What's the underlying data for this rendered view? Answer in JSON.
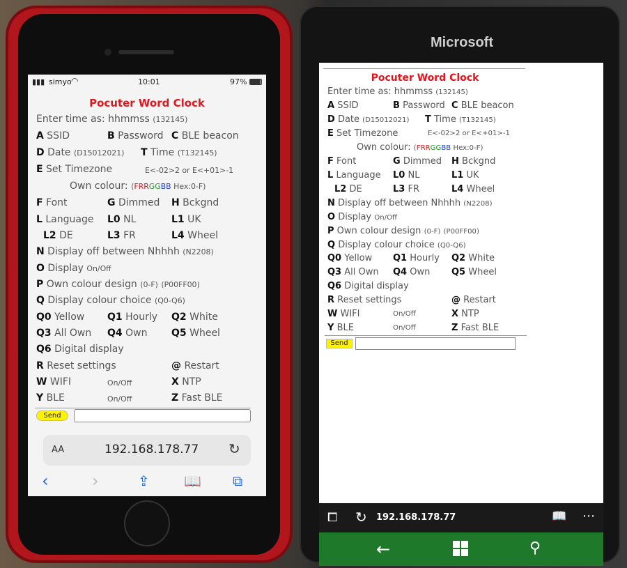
{
  "iphone": {
    "status": {
      "carrier": "simyo",
      "time": "10:01",
      "battery": "97%"
    },
    "title": "Pocuter Word Clock",
    "enter_time": "Enter time as: hhmmss",
    "enter_time_ex": "(132145)",
    "url": "192.168.178.77",
    "aa_label": "AA",
    "send_label": "Send"
  },
  "lumia": {
    "brand": "Microsoft",
    "title": "Pocuter Word Clock",
    "enter_time": "Enter time as: hhmmss",
    "enter_time_ex": "(132145)",
    "url": "192.168.178.77",
    "send_label": "Send"
  },
  "menu": {
    "a_key": "A",
    "a_label": "SSID",
    "b_key": "B",
    "b_label": "Password",
    "c_key": "C",
    "c_label": "BLE beacon",
    "d_key": "D",
    "d_label": "Date",
    "d_ex": "(D15012021)",
    "t_key": "T",
    "t_label": "Time",
    "t_ex": "(T132145)",
    "e_key": "E",
    "e_label": "Set Timezone",
    "e_ex": "E<-02>2 or E<+01>-1",
    "own_colour": "Own colour:",
    "own_ex_pre": "(",
    "own_rr": "RR",
    "own_gg": "GG",
    "own_bb": "BB",
    "own_ex_post": "Hex:0-F)",
    "own_f": "F",
    "f_key": "F",
    "f_label": "Font",
    "g_key": "G",
    "g_label": "Dimmed",
    "h_key": "H",
    "h_label": "Bckgnd",
    "l_key": "L",
    "l_label": "Language",
    "l0_key": "L0",
    "l0_label": "NL",
    "l1_key": "L1",
    "l1_label": "UK",
    "l2_key": "L2",
    "l2_label": "DE",
    "l3_key": "L3",
    "l3_label": "FR",
    "l4_key": "L4",
    "l4_label": "Wheel",
    "n_key": "N",
    "n_label": "Display off between Nhhhh",
    "n_ex": "(N2208)",
    "o_key": "O",
    "o_label": "Display",
    "o_ex": "On/Off",
    "p_key": "P",
    "p_label": "Own colour design",
    "p_ex1": "(0-F)",
    "p_ex2": "(P00FF00)",
    "q_key": "Q",
    "q_label": "Display colour choice",
    "q_ex": "(Q0-Q6)",
    "q0_key": "Q0",
    "q0_label": "Yellow",
    "q1_key": "Q1",
    "q1_label": "Hourly",
    "q2_key": "Q2",
    "q2_label": "White",
    "q3_key": "Q3",
    "q3_label": "All Own",
    "q4_key": "Q4",
    "q4_label": "Own",
    "q5_key": "Q5",
    "q5_label": "Wheel",
    "q6_key": "Q6",
    "q6_label": "Digital display",
    "r_key": "R",
    "r_label": "Reset settings",
    "at_key": "@",
    "at_label": "Restart",
    "w_key": "W",
    "w_label": "WIFI",
    "w_ex": "On/Off",
    "x_key": "X",
    "x_label": "NTP",
    "y_key": "Y",
    "y_label": "BLE",
    "y_ex": "On/Off",
    "z_key": "Z",
    "z_label": "Fast BLE"
  },
  "colors": {
    "title": "#e3141b",
    "send": "#fff200",
    "lumia_nav": "#1e7a2a",
    "phone_case": "#b0161c"
  }
}
